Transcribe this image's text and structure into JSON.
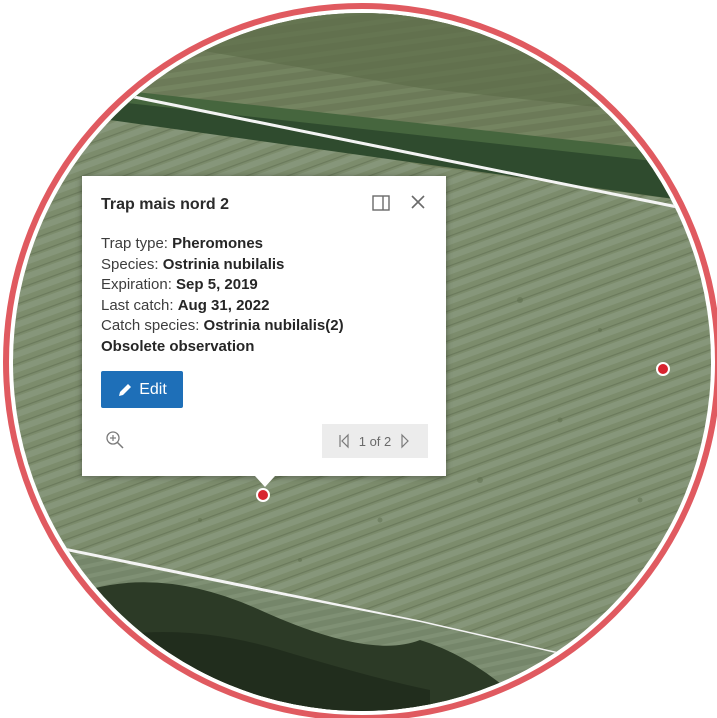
{
  "popup": {
    "title": "Trap mais nord 2",
    "rows": [
      {
        "label": "Trap type: ",
        "value": "Pheromones"
      },
      {
        "label": "Species: ",
        "value": "Ostrinia nubilalis"
      },
      {
        "label": "Expiration: ",
        "value": "Sep 5, 2019"
      },
      {
        "label": "Last catch: ",
        "value": "Aug 31, 2022"
      },
      {
        "label": "Catch species: ",
        "value": "Ostrinia nubilalis(2)"
      }
    ],
    "status": "Obsolete observation",
    "edit_label": "Edit",
    "pagination": "1 of 2"
  },
  "icons": {
    "dock": "dock-icon",
    "close": "close-icon",
    "edit": "pencil-icon",
    "zoom": "zoom-in-icon",
    "prev": "chevron-left-icon",
    "next": "chevron-right-icon"
  },
  "colors": {
    "frame_ring": "#e05a60",
    "edit_button": "#1e6fb8",
    "marker": "#d8232f",
    "field_base": "#7d8d6d",
    "hedge": "#2e4a2c",
    "pager_bg": "#ececec"
  }
}
